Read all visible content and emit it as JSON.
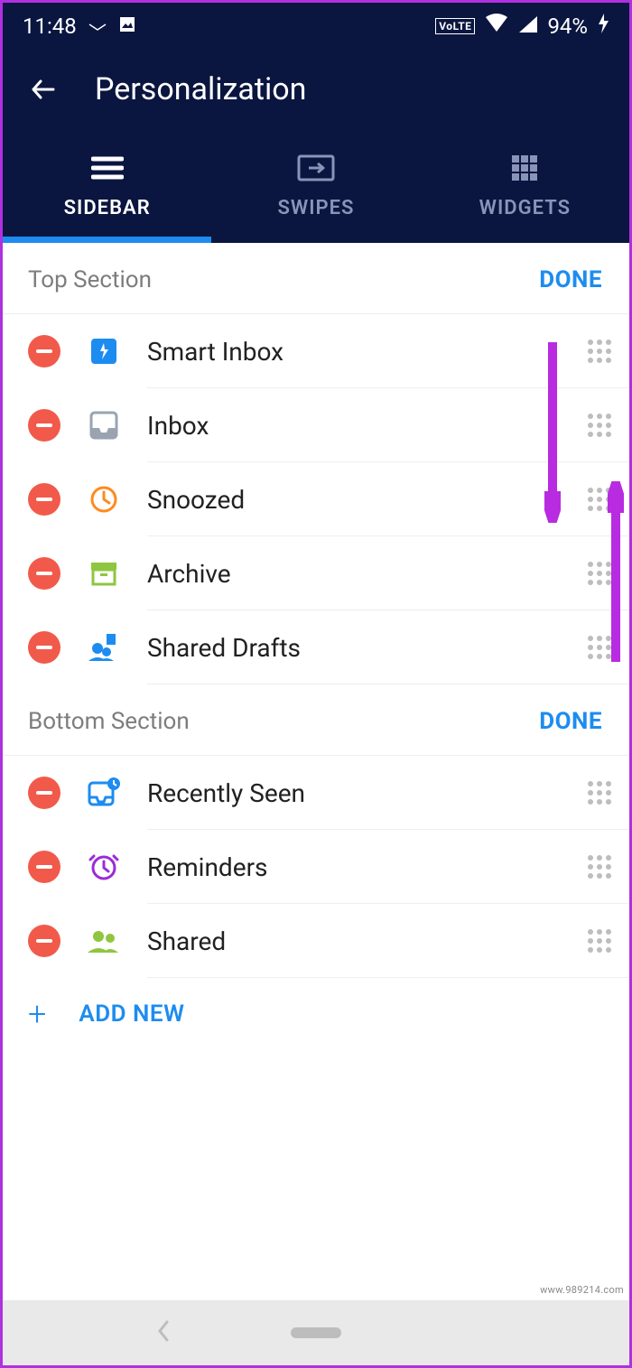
{
  "status": {
    "time": "11:48",
    "battery": "94%",
    "volte": "VoLTE"
  },
  "header": {
    "title": "Personalization"
  },
  "tabs": {
    "sidebar": "SIDEBAR",
    "swipes": "SWIPES",
    "widgets": "WIDGETS"
  },
  "sections": {
    "top": {
      "title": "Top Section",
      "done": "DONE",
      "items": [
        {
          "label": "Smart Inbox",
          "icon": "smart-inbox"
        },
        {
          "label": "Inbox",
          "icon": "inbox"
        },
        {
          "label": "Snoozed",
          "icon": "snoozed"
        },
        {
          "label": "Archive",
          "icon": "archive"
        },
        {
          "label": "Shared Drafts",
          "icon": "shared-drafts"
        }
      ]
    },
    "bottom": {
      "title": "Bottom Section",
      "done": "DONE",
      "items": [
        {
          "label": "Recently Seen",
          "icon": "recently-seen"
        },
        {
          "label": "Reminders",
          "icon": "reminders"
        },
        {
          "label": "Shared",
          "icon": "shared"
        }
      ]
    }
  },
  "add_new": "ADD NEW",
  "watermark": "www.989214.com"
}
